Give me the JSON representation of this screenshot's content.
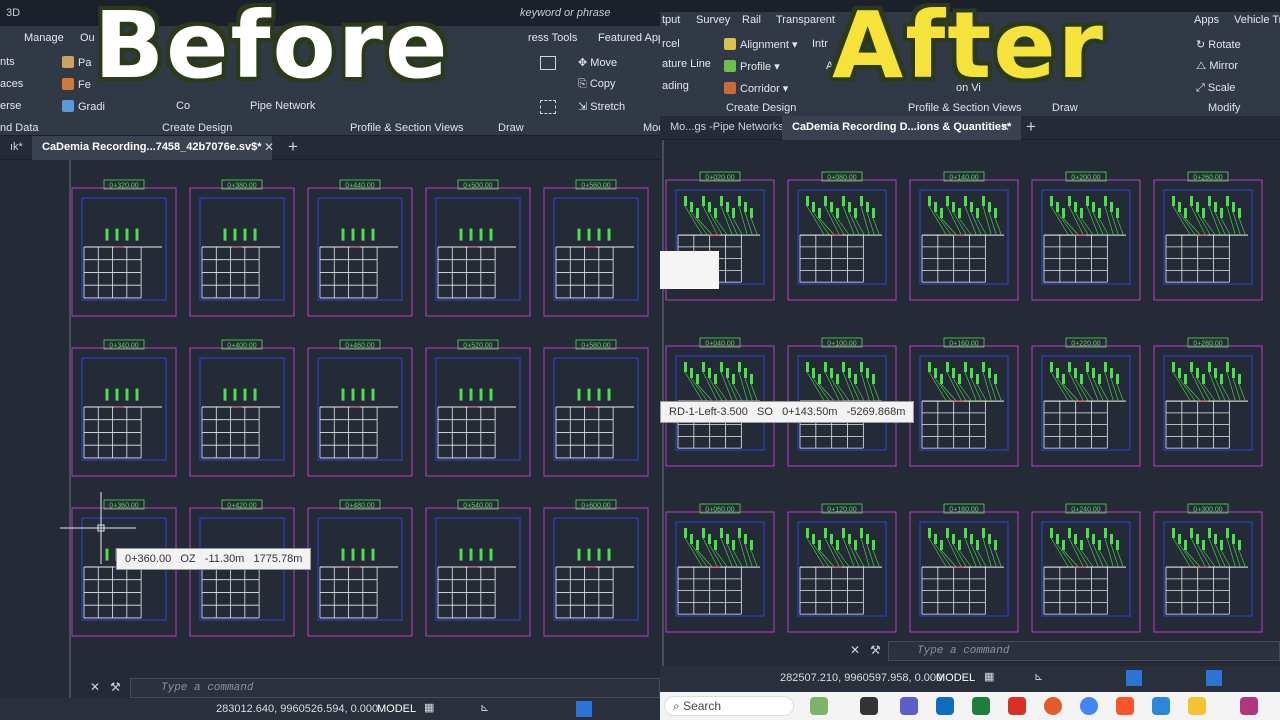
{
  "overlay": {
    "before": "Before",
    "after": "After",
    "before_color": "#ffffff",
    "after_color": "#f5e33b",
    "outline_color": "#2c3a1c"
  },
  "left": {
    "title_fragments": [
      "3D",
      "keyword or phrase"
    ],
    "ribbon_tabs": [
      "Manage",
      "Ou"
    ],
    "ribbon_btns": [
      "nts",
      "aces",
      "erse",
      "Pa",
      "Fe",
      "Gradi",
      "Co",
      "Pipe Network",
      "Move",
      "Copy",
      "Stretch"
    ],
    "ribbon_panels": [
      "nd Data",
      "Create Design",
      "Profile & Section Views",
      "Draw",
      "Mod"
    ],
    "tooltip_ribbon": "ress Tools",
    "featured": "Featured App",
    "doc_tabs": [
      {
        "label": "ık*",
        "active": false
      },
      {
        "label": "CaDemia Recording...7458_42b7076e.sv$*",
        "active": true
      }
    ],
    "stations_row1": [
      "0+320.00",
      "0+380.00",
      "0+440.00",
      "0+500.00",
      "0+560.00"
    ],
    "stations_row2": [
      "0+340.00",
      "0+400.00",
      "0+460.00",
      "0+520.00",
      "0+580.00"
    ],
    "stations_row3": [
      "0+360.00",
      "0+420.00",
      "0+480.00",
      "0+540.00",
      "0+600.00"
    ],
    "tooltip": {
      "station": "0+360.00",
      "side": "OZ",
      "offset": "-11.30m",
      "elevation": "1775.78m"
    },
    "command_placeholder": "Type a command",
    "coords": "283012.640, 9960526.594, 0.000",
    "model": "MODEL"
  },
  "right": {
    "ribbon_tabs": [
      "tput",
      "Survey",
      "Rail",
      "Transparent",
      "Apps",
      "Vehicle Tr"
    ],
    "ribbon_btns": [
      "rcel",
      "ature Line",
      "ading",
      "Alignment",
      "Profile",
      "Corridor",
      "Intr",
      "A",
      "on Vi",
      "Rotate",
      "Mirror",
      "Scale"
    ],
    "ribbon_panels": [
      "Create Design",
      "Profile & Section Views",
      "Draw",
      "Modify"
    ],
    "doc_tabs": [
      {
        "label": "Mo...gs -Pipe Networks*",
        "active": false
      },
      {
        "label": "CaDemia Recording D...ions & Quantities*",
        "active": true
      }
    ],
    "stations_row1": [
      "0+020.00",
      "0+080.00",
      "0+140.00",
      "0+200.00",
      "0+260.00"
    ],
    "stations_row2": [
      "0+040.00",
      "0+100.00",
      "0+160.00",
      "0+220.00",
      "0+280.00"
    ],
    "stations_row3": [
      "0+060.00",
      "0+120.00",
      "0+180.00",
      "0+240.00",
      "0+300.00"
    ],
    "tooltip": {
      "alignment": "RD-1-Left-3.500",
      "side": "SO",
      "station": "0+143.50m",
      "value": "-5269.868m"
    },
    "command_placeholder": "Type a command",
    "coords": "282507.210, 9960597.958, 0.000",
    "model": "MODEL",
    "taskbar_search": "Search"
  },
  "colors": {
    "frame": "#c03bd0",
    "inner": "#2a3fc8",
    "grid": "#e8e8e8",
    "label": "#4be04b",
    "bg": "#252b36"
  }
}
